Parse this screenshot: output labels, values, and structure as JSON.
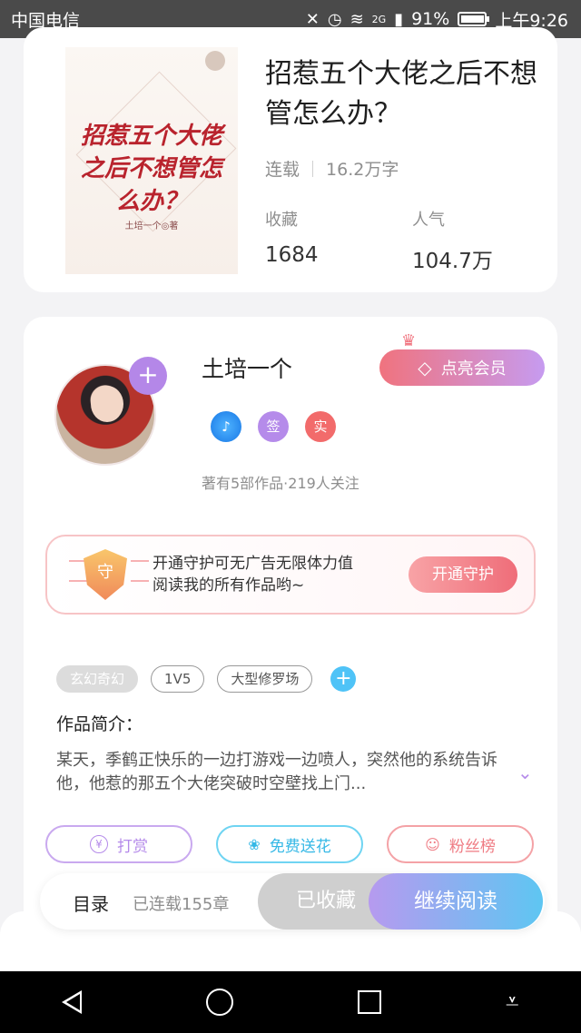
{
  "status_bar": {
    "carrier": "中国电信",
    "network": "2G",
    "battery": "91%",
    "time": "上午9:26",
    "icons": [
      "mute-icon",
      "alarm-icon",
      "wifi-icon",
      "signal-icon",
      "battery-icon"
    ]
  },
  "book": {
    "cover_title": "招惹五个大佬之后不想管怎么办？",
    "cover_author": "土培一个◎著",
    "title": "招惹五个大佬之后不想管怎么办？",
    "status": "连载",
    "word_count": "16.2万字",
    "stats": [
      {
        "label": "收藏",
        "value": "1684"
      },
      {
        "label": "人气",
        "value": "104.7万"
      }
    ]
  },
  "author": {
    "name": "土培一个",
    "badges": [
      "♪",
      "签",
      "实"
    ],
    "stats": "著有5部作品·219人关注",
    "vip_button": "点亮会员"
  },
  "guard": {
    "shield_char": "守",
    "line1": "开通守护可无广告无限体力值",
    "line2": "阅读我的所有作品哟~",
    "button": "开通守护"
  },
  "tags": [
    "玄幻奇幻",
    "1V5",
    "大型修罗场"
  ],
  "intro": {
    "title": "作品简介：",
    "text": "某天，季鹤正快乐的一边打游戏一边喷人，突然他的系统告诉他，他惹的那五个大佬突破时空壁找上门..."
  },
  "actions": [
    {
      "label": "打赏",
      "icon": "coin-icon"
    },
    {
      "label": "免费送花",
      "icon": "flower-icon"
    },
    {
      "label": "粉丝榜",
      "icon": "fans-icon"
    }
  ],
  "read_bar": {
    "toc": "目录",
    "chapters": "已连载155章",
    "collected": "已收藏",
    "continue": "继续阅读"
  },
  "colors": {
    "accent_purple": "#b58bea",
    "accent_blue": "#5ec6f2",
    "accent_pink": "#ef6d79"
  }
}
